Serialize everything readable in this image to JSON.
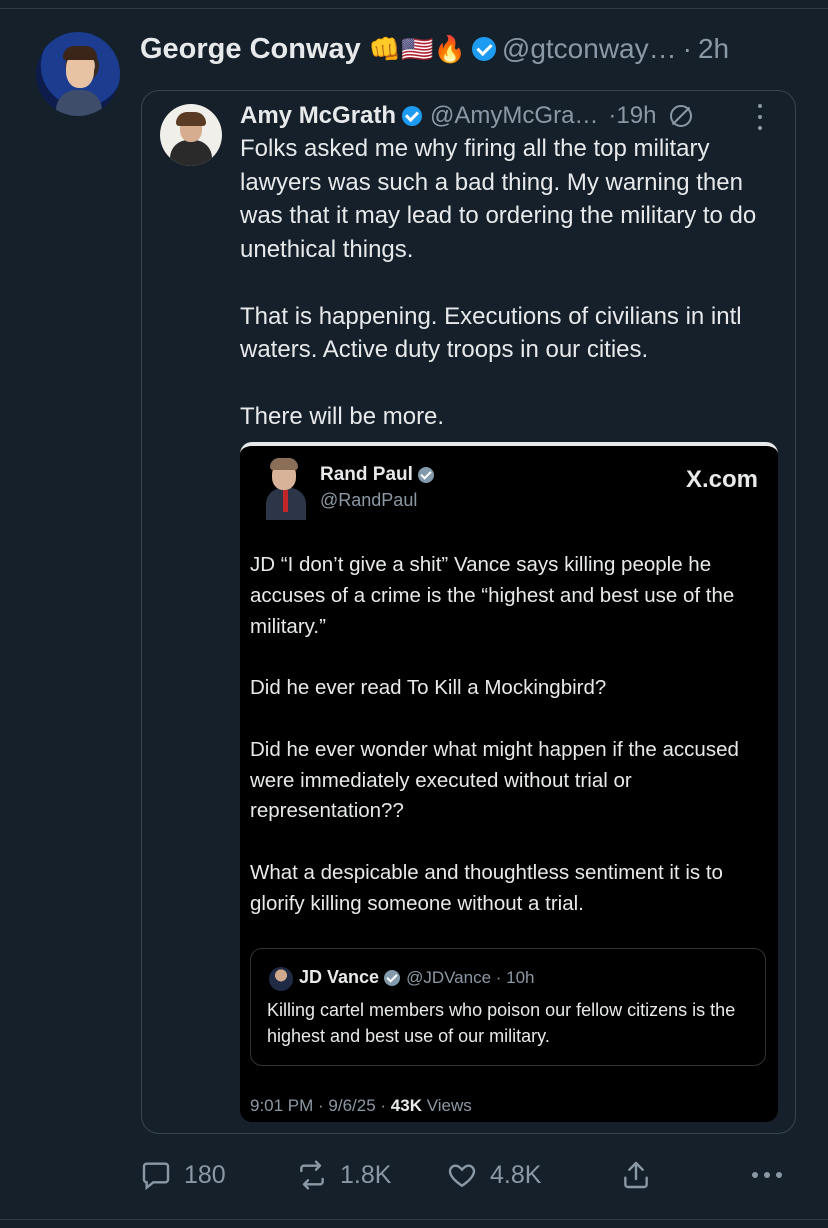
{
  "colors": {
    "background": "#15202b",
    "text": "#e7e9ea",
    "muted": "#8b98a5",
    "verified": "#1d9bf0",
    "border": "#38444d"
  },
  "post": {
    "author_name": "George Conway",
    "emojis": "👊🇺🇸🔥",
    "handle": "@gtconway…",
    "separator": "·",
    "time": "2h",
    "avatar_icon": "avatar"
  },
  "quote": {
    "author_name": "Amy McGrath",
    "handle": "@AmyMcGra…",
    "time": "·19h",
    "paragraphs": [
      "Folks asked me why firing all the top military lawyers was such a bad thing. My warning then was that it may lead to ordering the military to do unethical things.",
      "That is happening. Executions of civilians in intl waters. Active duty troops in our cities.",
      "There will be more."
    ]
  },
  "embed": {
    "author_name": "Rand Paul",
    "handle": "@RandPaul",
    "brand": "X.com",
    "paragraphs": [
      "JD “I don’t give a shit” Vance says killing people he accuses of a crime is the “highest and best use of the military.”",
      "Did he ever read To Kill a Mockingbird?",
      "Did he ever wonder what might happen if the accused were immediately executed without trial or representation??",
      "What a despicable and thoughtless sentiment it is to glorify killing someone without a trial."
    ],
    "inner_quote": {
      "author_name": "JD Vance",
      "handle": "@JDVance · 10h",
      "text": "Killing cartel members who poison our fellow citizens is the highest and best use of our military."
    },
    "footer": {
      "timestamp": "9:01 PM · 9/6/25 · ",
      "views_count": "43K",
      "views_label": " Views"
    }
  },
  "actions": {
    "replies": "180",
    "reposts": "1.8K",
    "likes": "4.8K"
  }
}
